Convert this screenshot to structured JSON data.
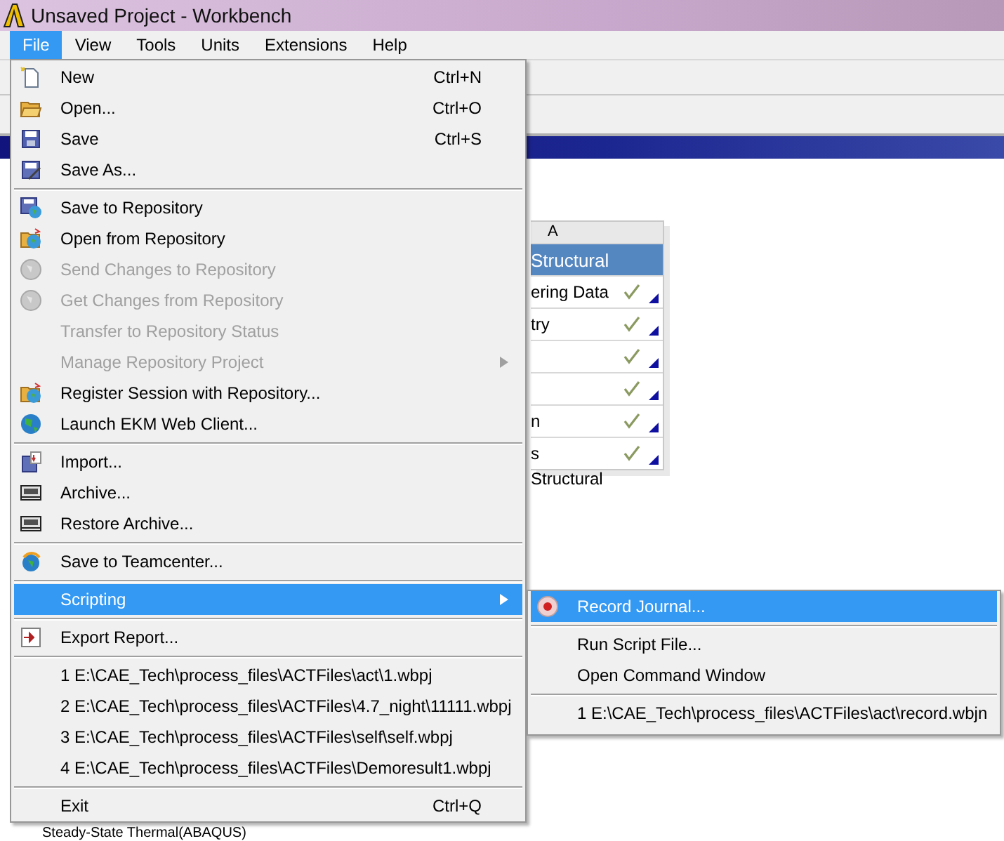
{
  "window": {
    "title": "Unsaved Project - Workbench"
  },
  "menubar": [
    {
      "label": "File",
      "selected": true
    },
    {
      "label": "View",
      "selected": false
    },
    {
      "label": "Tools",
      "selected": false
    },
    {
      "label": "Units",
      "selected": false
    },
    {
      "label": "Extensions",
      "selected": false
    },
    {
      "label": "Help",
      "selected": false
    }
  ],
  "schematic": {
    "column": "A",
    "caption": "Structural",
    "rows": [
      {
        "kind": "title",
        "label": "Structural"
      },
      {
        "kind": "cell",
        "label": "ering Data",
        "done": true
      },
      {
        "kind": "cell",
        "label": "try",
        "done": true
      },
      {
        "kind": "cell",
        "done": true
      },
      {
        "kind": "cell",
        "done": true
      },
      {
        "kind": "cell",
        "label": "n",
        "done": true
      },
      {
        "kind": "cell",
        "label": "s",
        "done": true
      }
    ]
  },
  "outline": {
    "item": "Steady-State Thermal(ABAQUS)"
  },
  "file_menu": {
    "groups": [
      [
        {
          "label": "New",
          "shortcut": "Ctrl+N",
          "disabled": false,
          "submenu": false,
          "selected": false
        },
        {
          "label": "Open...",
          "shortcut": "Ctrl+O",
          "disabled": false,
          "submenu": false,
          "selected": false
        },
        {
          "label": "Save",
          "shortcut": "Ctrl+S",
          "disabled": false,
          "submenu": false,
          "selected": false
        },
        {
          "label": "Save As...",
          "disabled": false,
          "submenu": false,
          "selected": false
        }
      ],
      [
        {
          "label": "Save to Repository",
          "disabled": false,
          "submenu": false,
          "selected": false
        },
        {
          "label": "Open from Repository",
          "disabled": false,
          "submenu": false,
          "selected": false
        },
        {
          "label": "Send Changes to Repository",
          "disabled": true,
          "submenu": false,
          "selected": false
        },
        {
          "label": "Get Changes from Repository",
          "disabled": true,
          "submenu": false,
          "selected": false
        },
        {
          "label": "Transfer to Repository Status",
          "disabled": true,
          "submenu": false,
          "selected": false
        },
        {
          "label": "Manage Repository Project",
          "disabled": true,
          "submenu": true,
          "selected": false
        },
        {
          "label": "Register Session with Repository...",
          "disabled": false,
          "submenu": false,
          "selected": false
        },
        {
          "label": "Launch EKM Web Client...",
          "disabled": false,
          "submenu": false,
          "selected": false
        }
      ],
      [
        {
          "label": "Import...",
          "disabled": false,
          "submenu": false,
          "selected": false
        },
        {
          "label": "Archive...",
          "disabled": false,
          "submenu": false,
          "selected": false
        },
        {
          "label": "Restore Archive...",
          "disabled": false,
          "submenu": false,
          "selected": false
        }
      ],
      [
        {
          "label": "Save to Teamcenter...",
          "disabled": false,
          "submenu": false,
          "selected": false
        }
      ],
      [
        {
          "label": "Scripting",
          "disabled": false,
          "submenu": true,
          "selected": true
        }
      ],
      [
        {
          "label": "Export Report...",
          "disabled": false,
          "submenu": false,
          "selected": false
        }
      ],
      [
        {
          "label": "1 E:\\CAE_Tech\\process_files\\ACTFiles\\act\\1.wbpj",
          "disabled": false,
          "submenu": false,
          "selected": false
        },
        {
          "label": "2 E:\\CAE_Tech\\process_files\\ACTFiles\\4.7_night\\11111.wbpj",
          "disabled": false,
          "submenu": false,
          "selected": false
        },
        {
          "label": "3 E:\\CAE_Tech\\process_files\\ACTFiles\\self\\self.wbpj",
          "disabled": false,
          "submenu": false,
          "selected": false
        },
        {
          "label": "4 E:\\CAE_Tech\\process_files\\ACTFiles\\Demoresult1.wbpj",
          "disabled": false,
          "submenu": false,
          "selected": false
        }
      ],
      [
        {
          "label": "Exit",
          "shortcut": "Ctrl+Q",
          "disabled": false,
          "submenu": false,
          "selected": false
        }
      ]
    ]
  },
  "scripting_menu": {
    "groups": [
      [
        {
          "label": "Record Journal...",
          "selected": true
        }
      ],
      [
        {
          "label": "Run Script File...",
          "selected": false
        },
        {
          "label": "Open Command Window",
          "selected": false
        }
      ],
      [
        {
          "label": "1 E:\\CAE_Tech\\process_files\\ACTFiles\\act\\record.wbjn",
          "selected": false
        }
      ]
    ]
  }
}
